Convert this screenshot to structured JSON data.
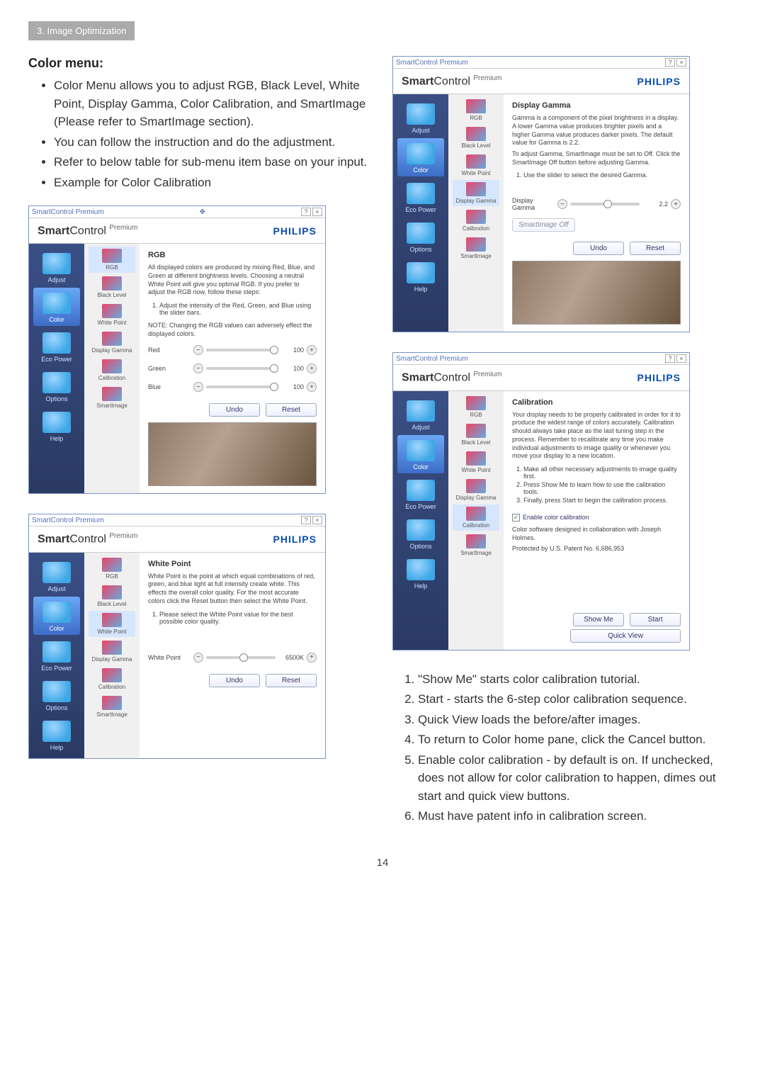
{
  "section_tab": "3. Image Optimization",
  "heading": "Color menu:",
  "bullets": [
    "Color Menu allows you to adjust RGB, Black Level, White Point, Display Gamma, Color Calibration, and SmartImage (Please refer to SmartImage section).",
    "You can follow the instruction and do the adjustment.",
    "Refer to below table for sub-menu item base on your input.",
    "Example for Color Calibration"
  ],
  "numbers": [
    "\"Show Me\" starts color calibration tutorial.",
    "Start - starts the 6-step color calibration sequence.",
    "Quick View loads the before/after images.",
    "To return to Color home pane, click the Cancel button.",
    "Enable color calibration - by default is on. If unchecked, does not allow for color calibration to happen, dimes out start and quick view buttons.",
    "Must have patent info in calibration screen."
  ],
  "window": {
    "title": "SmartControl Premium",
    "brand_bold": "Smart",
    "brand_norm": "Control",
    "brand_sup": "Premium",
    "logo": "PHILIPS",
    "help_btn": "?",
    "close_btn": "×",
    "move_btn": "✥",
    "sidebar": {
      "adjust": "Adjust",
      "color": "Color",
      "eco": "Eco Power",
      "options": "Options",
      "help": "Help"
    },
    "submenu": {
      "rgb": "RGB",
      "black": "Black Level",
      "white": "White Point",
      "gamma": "Display Gamma",
      "calib": "Calibration",
      "smart": "SmartImage"
    },
    "btn_undo": "Undo",
    "btn_reset": "Reset",
    "btn_showme": "Show Me",
    "btn_start": "Start",
    "btn_quick": "Quick View",
    "smartimage_off": "SmartImage Off"
  },
  "panel_rgb": {
    "title": "RGB",
    "desc1": "All displayed colors are produced by mixing Red, Blue, and Green at different brightness levels. Choosing a neutral White Point will give you optimal RGB. If you prefer to adjust the RGB now, follow these steps:",
    "step1": "Adjust the intensity of the Red, Green, and Blue using the slider bars.",
    "note": "NOTE: Changing the RGB values can adversely effect the displayed colors.",
    "red_lbl": "Red",
    "red_val": "100",
    "green_lbl": "Green",
    "green_val": "100",
    "blue_lbl": "Blue",
    "blue_val": "100"
  },
  "panel_white": {
    "title": "White Point",
    "desc1": "White Point is the point at which equal combinations of red, green, and blue light at full intensity create white. This effects the overall color quality. For the most accurate colors click the Reset button then select the White Point.",
    "step1": "Please select the White Point value for the best possible color quality.",
    "lbl": "White Point",
    "val": "6500K"
  },
  "panel_gamma": {
    "title": "Display Gamma",
    "desc1": "Gamma is a component of the pixel brightness in a display. A lower Gamma value produces brighter pixels and a higher Gamma value produces darker pixels. The default value for Gamma is 2.2.",
    "desc2": "To adjust Gamma, SmartImage must be set to Off. Click the SmartImage Off button before adjusting Gamma.",
    "step1": "Use the slider to select the desired Gamma.",
    "lbl": "Display Gamma",
    "val": "2.2"
  },
  "panel_calib": {
    "title": "Calibration",
    "desc1": "Your display needs to be properly calibrated in order for it to produce the widest range of colors accurately. Calibration should always take place as the last tuning step in the process. Remember to recalibrate any time you make individual adjustments to image quality or whenever you move your display to a new location.",
    "step1": "Make all other necessary adjustments to image quality first.",
    "step2": "Press Show Me to learn how to use the calibration tools.",
    "step3": "Finally, press Start to begin the calibration process.",
    "chk": "Enable color calibration",
    "desc2": "Color software designed in collaboration with Joseph Holmes.",
    "desc3": "Protected by U.S. Patent No. 6,686,953"
  },
  "page_number": "14"
}
